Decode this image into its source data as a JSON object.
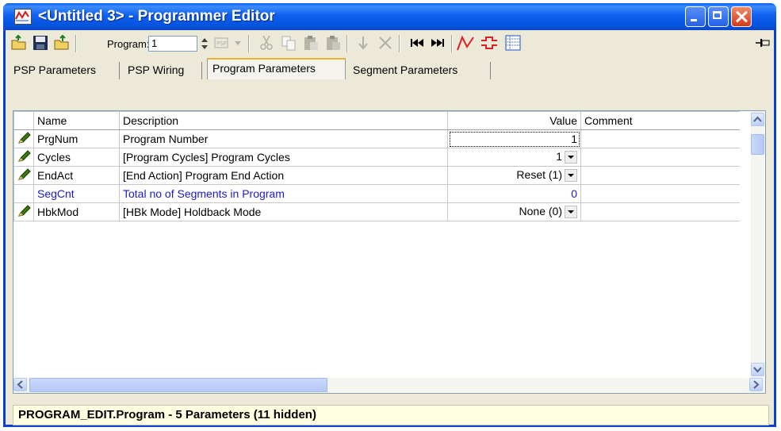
{
  "window": {
    "title": "<Untitled 3> - Programmer Editor"
  },
  "toolbar": {
    "program_label": "Program:",
    "program_value": "1"
  },
  "tabs": [
    {
      "label": "PSP Parameters"
    },
    {
      "label": "PSP Wiring"
    },
    {
      "label": "Program Parameters"
    },
    {
      "label": "Segment Parameters"
    }
  ],
  "grid": {
    "columns": {
      "name": "Name",
      "description": "Description",
      "value": "Value",
      "comment": "Comment"
    },
    "rows": [
      {
        "name": "PrgNum",
        "description": "Program Number",
        "value": "1",
        "comment": "",
        "editable": true,
        "dropdown": false
      },
      {
        "name": "Cycles",
        "description": "[Program Cycles]  Program Cycles",
        "value": "1",
        "comment": "",
        "editable": true,
        "dropdown": true
      },
      {
        "name": "EndAct",
        "description": "[End Action]  Program End Action",
        "value": "Reset (1)",
        "comment": "",
        "editable": true,
        "dropdown": true
      },
      {
        "name": "SegCnt",
        "description": "Total no of Segments in Program",
        "value": "0",
        "comment": "",
        "editable": false,
        "dropdown": false
      },
      {
        "name": "HbkMod",
        "description": "[HBk Mode]  Holdback Mode",
        "value": "None (0)",
        "comment": "",
        "editable": true,
        "dropdown": true
      }
    ]
  },
  "status": {
    "text": "PROGRAM_EDIT.Program  -  5 Parameters (11 hidden)"
  },
  "colors": {
    "titlebar": "#0454e0",
    "readonly_row": "#1a1ad0",
    "status_bg": "#ffffe1",
    "accent_red": "#e02020"
  }
}
